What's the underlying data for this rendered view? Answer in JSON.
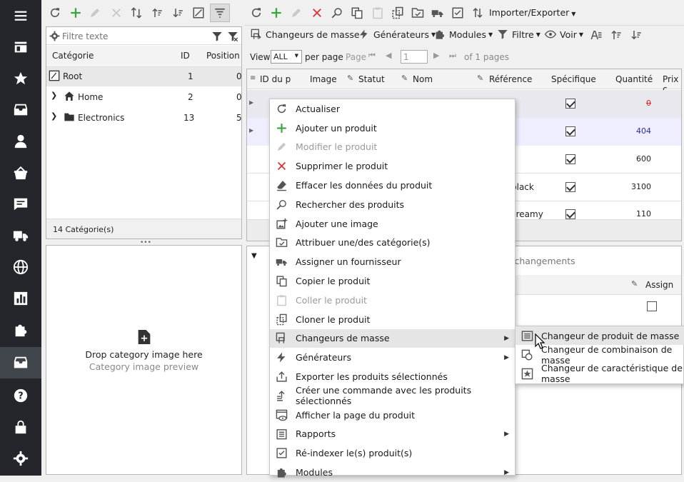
{
  "sidebar": {
    "icons": [
      "menu-icon",
      "store-icon",
      "star-icon",
      "inbox-icon",
      "user-icon",
      "basket-icon",
      "chat-icon",
      "truck-icon",
      "globe-icon",
      "chart-icon",
      "puzzle-icon",
      "catalog-icon",
      "help-icon",
      "lock-icon",
      "gear-icon"
    ]
  },
  "categories": {
    "filter_placeholder": "Filtre texte",
    "headers": {
      "category": "Catégorie",
      "id": "ID",
      "position": "Position"
    },
    "rows": [
      {
        "name": "Root",
        "id": "1",
        "position": "0"
      },
      {
        "name": "Home",
        "id": "2",
        "position": "0"
      },
      {
        "name": "Electronics",
        "id": "13",
        "position": "5"
      }
    ],
    "footer": "14 Catégorie(s)",
    "drop_title": "Drop category image here",
    "drop_sub": "Category image preview"
  },
  "products": {
    "import_export": "Importer/Exporter",
    "toolbar2": {
      "mass_changers": "Changeurs de masse",
      "generators": "Générateurs",
      "modules": "Modules",
      "filter": "Filtre",
      "view": "Voir"
    },
    "pager": {
      "view": "View",
      "per_page_value": "ALL",
      "per_page": "per page",
      "page": "Page",
      "page_value": "1",
      "of_pages": "of 1 pages"
    },
    "headers": {
      "id": "ID du p",
      "image": "Image",
      "status": "Statut",
      "name": "Nom",
      "reference": "Référence",
      "specific": "Spécifique",
      "quantity": "Quantité",
      "price": "Prix c"
    },
    "rows": [
      {
        "reference": "",
        "quantity": "0"
      },
      {
        "reference": "",
        "quantity": "404"
      },
      {
        "reference": "",
        "quantity": "600"
      },
      {
        "reference": "black",
        "quantity": "3100"
      },
      {
        "reference": "creamy",
        "quantity": "110"
      }
    ],
    "bottom": {
      "changes": "s changements",
      "assign": "Assign"
    }
  },
  "context_menu": {
    "items": [
      {
        "label": "Actualiser",
        "icon": "refresh-icon"
      },
      {
        "label": "Ajouter un produit",
        "icon": "plus-icon"
      },
      {
        "label": "Modifier le produit",
        "icon": "pencil-icon",
        "disabled": true
      },
      {
        "label": "Supprimer le produit",
        "icon": "delete-icon"
      },
      {
        "label": "Effacer les données du produit",
        "icon": "eraser-icon"
      },
      {
        "label": "Rechercher des produits",
        "icon": "search-icon"
      },
      {
        "label": "Ajouter une image",
        "icon": "add-image-icon"
      },
      {
        "label": "Attribuer une/des catégorie(s)",
        "icon": "category-icon"
      },
      {
        "label": "Assigner un fournisseur",
        "icon": "supplier-icon"
      },
      {
        "label": "Copier le produit",
        "icon": "copy-icon"
      },
      {
        "label": "Coller le produit",
        "icon": "paste-icon",
        "disabled": true
      },
      {
        "label": "Cloner le produit",
        "icon": "clone-icon"
      },
      {
        "label": "Changeurs de masse",
        "icon": "mass-change-icon",
        "submenu": true
      },
      {
        "label": "Générateurs",
        "icon": "generator-icon",
        "submenu": true
      },
      {
        "label": "Exporter les produits sélectionnés",
        "icon": "export-icon"
      },
      {
        "label": "Créer une commande avec les produits sélectionnés",
        "icon": "order-icon"
      },
      {
        "label": "Afficher la page du produit",
        "icon": "view-page-icon"
      },
      {
        "label": "Rapports",
        "icon": "report-icon",
        "submenu": true
      },
      {
        "label": "Ré-indexer le(s) produit(s)",
        "icon": "reindex-icon"
      },
      {
        "label": "Modules",
        "icon": "modules-icon",
        "submenu": true
      }
    ]
  },
  "submenu": {
    "items": [
      {
        "label": "Changeur de produit de masse",
        "icon": "product-mass-icon"
      },
      {
        "label": "Changeur de combinaison de masse",
        "icon": "combination-mass-icon"
      },
      {
        "label": "Changeur de caractéristique de masse",
        "icon": "feature-mass-icon"
      }
    ]
  }
}
